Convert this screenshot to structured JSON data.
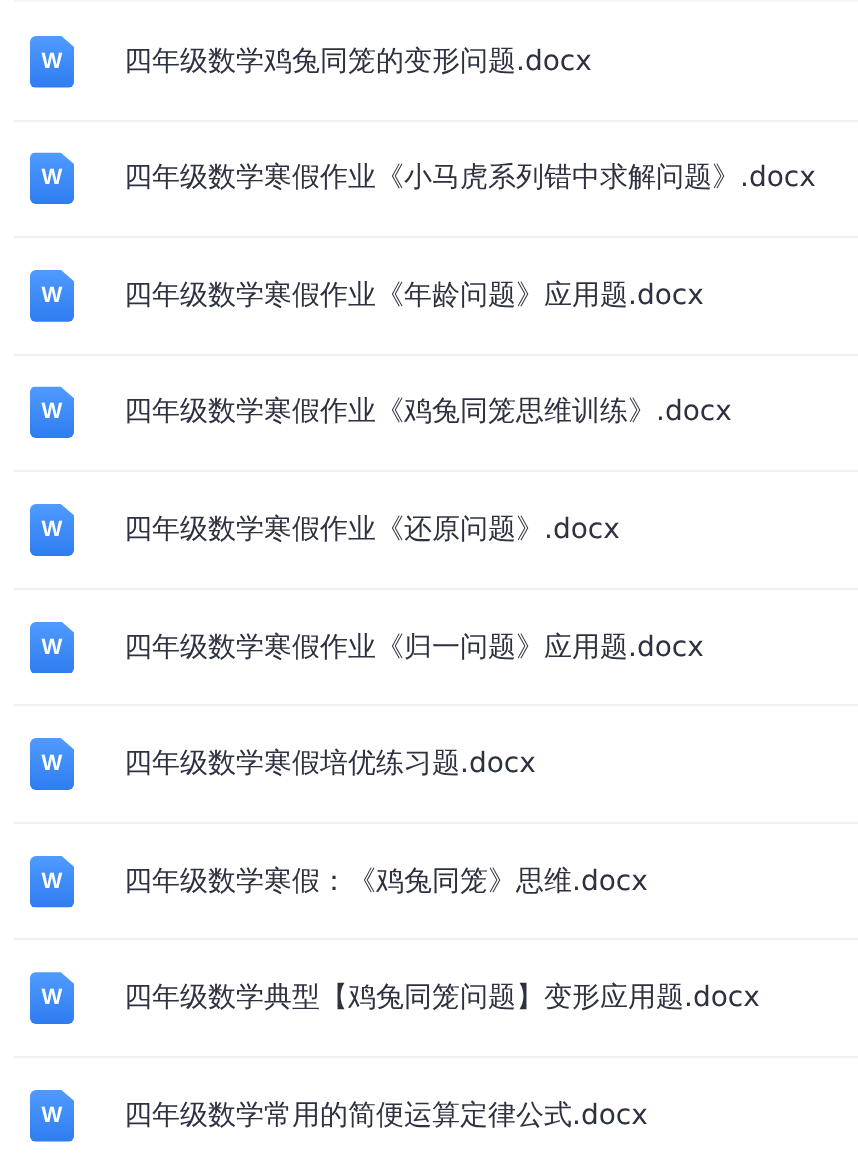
{
  "files": [
    {
      "icon_text": "W",
      "name": "四年级数学鸡兔同笼的变形问题.docx"
    },
    {
      "icon_text": "W",
      "name": "四年级数学寒假作业《小马虎系列错中求解问题》.docx"
    },
    {
      "icon_text": "W",
      "name": "四年级数学寒假作业《年龄问题》应用题.docx"
    },
    {
      "icon_text": "W",
      "name": "四年级数学寒假作业《鸡兔同笼思维训练》.docx"
    },
    {
      "icon_text": "W",
      "name": "四年级数学寒假作业《还原问题》.docx"
    },
    {
      "icon_text": "W",
      "name": "四年级数学寒假作业《归一问题》应用题.docx"
    },
    {
      "icon_text": "W",
      "name": "四年级数学寒假培优练习题.docx"
    },
    {
      "icon_text": "W",
      "name": "四年级数学寒假：《鸡兔同笼》思维.docx"
    },
    {
      "icon_text": "W",
      "name": "四年级数学典型【鸡兔同笼问题】变形应用题.docx"
    },
    {
      "icon_text": "W",
      "name": "四年级数学常用的简便运算定律公式.docx"
    }
  ]
}
